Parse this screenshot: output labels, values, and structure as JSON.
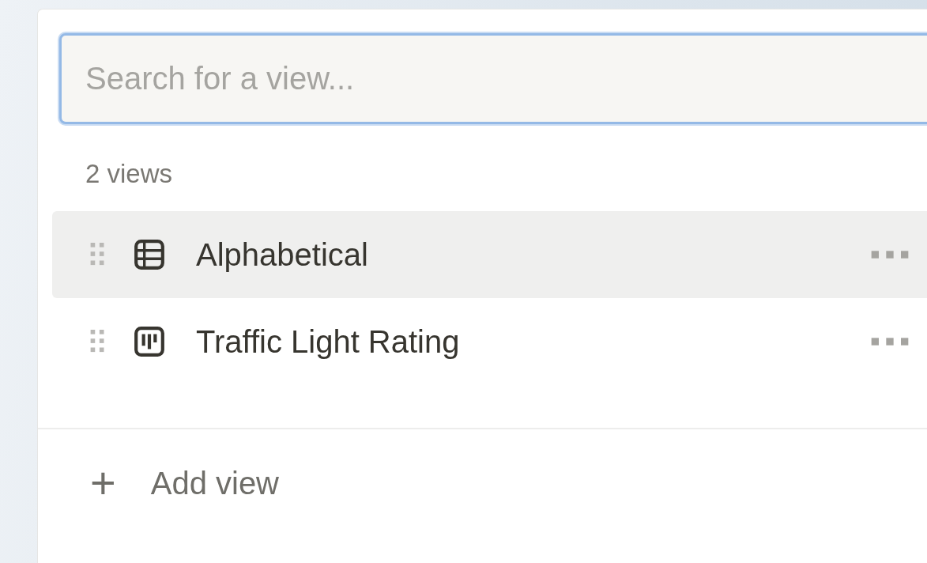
{
  "search": {
    "placeholder": "Search for a view..."
  },
  "count_label": "2 views",
  "views": [
    {
      "name": "Alphabetical",
      "kind": "table",
      "selected": true
    },
    {
      "name": "Traffic Light Rating",
      "kind": "board",
      "selected": false
    }
  ],
  "add_view": {
    "icon": "+",
    "label": "Add view"
  }
}
